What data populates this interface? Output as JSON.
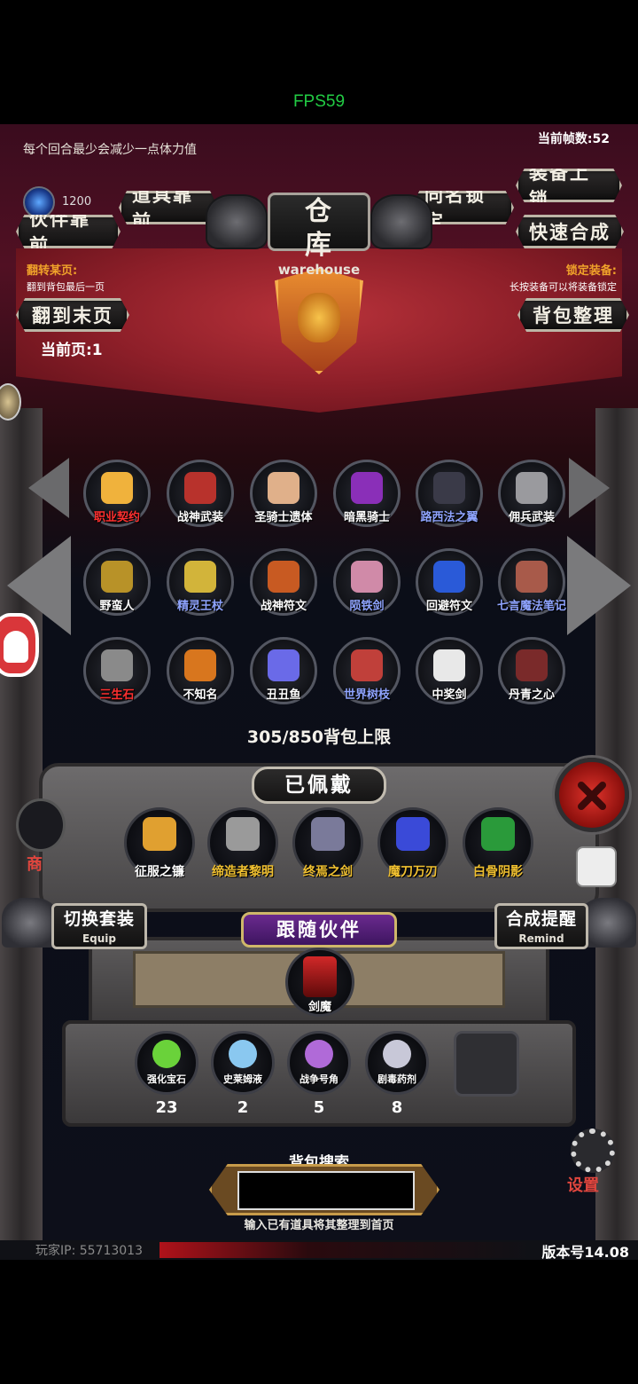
{
  "status": {
    "fps": "FPS59"
  },
  "header": {
    "hint": "每个回合最少会减少一点体力值",
    "current_fps": "当前帧数:52",
    "gem_count": "1200"
  },
  "title": {
    "cn": "仓 库",
    "en": "warehouse"
  },
  "buttons": {
    "items_front": "道具靠前",
    "partners_front": "伙伴靠前",
    "same_name_lock": "同名锁定",
    "equip_lock": "装备上锁",
    "quick_merge": "快速合成",
    "to_last_page": "翻到末页",
    "sort_bag": "背包整理"
  },
  "labels": {
    "flip_page": "翻转某页:",
    "flip_page_sub": "翻到背包最后一页",
    "lock_equip": "锁定装备:",
    "lock_equip_sub": "长按装备可以将装备锁定",
    "current_page": "当前页:1",
    "capacity": "305/850背包上限"
  },
  "inventory": [
    {
      "name": "职业契约",
      "color": "#ff3030",
      "art": "#f0b23c"
    },
    {
      "name": "战神武装",
      "color": "#ffffff",
      "art": "#b8322c"
    },
    {
      "name": "圣骑士遗体",
      "color": "#ffffff",
      "art": "#e0b08a"
    },
    {
      "name": "暗黑骑士",
      "color": "#ffffff",
      "art": "#8a2fb8"
    },
    {
      "name": "路西法之翼",
      "color": "#8fa4ff",
      "art": "#3a3a48"
    },
    {
      "name": "佣兵武装",
      "color": "#ffffff",
      "art": "#9a9a9e"
    },
    {
      "name": "野蛮人",
      "color": "#ffffff",
      "art": "#b89228"
    },
    {
      "name": "精灵王杖",
      "color": "#8fa4ff",
      "art": "#d2b43a"
    },
    {
      "name": "战神符文",
      "color": "#ffffff",
      "art": "#c85a22"
    },
    {
      "name": "陨铁剑",
      "color": "#8fa4ff",
      "art": "#d08aa8"
    },
    {
      "name": "回避符文",
      "color": "#ffffff",
      "art": "#2a5ad8"
    },
    {
      "name": "七言魔法笔记",
      "color": "#8fa4ff",
      "art": "#a85a4a"
    },
    {
      "name": "三生石",
      "color": "#ff3030",
      "art": "#8a8a8a"
    },
    {
      "name": "不知名",
      "color": "#ffffff",
      "art": "#d8761e"
    },
    {
      "name": "丑丑鱼",
      "color": "#ffffff",
      "art": "#6a6ae8"
    },
    {
      "name": "世界树枝",
      "color": "#8fa4ff",
      "art": "#c0403a"
    },
    {
      "name": "中奖剑",
      "color": "#ffffff",
      "art": "#e8e8e8"
    },
    {
      "name": "丹青之心",
      "color": "#ffffff",
      "art": "#7a2a2a"
    }
  ],
  "equipped": {
    "title": "已佩戴",
    "items": [
      {
        "name": "征服之镰",
        "color": "#ffffff",
        "art": "#e0a030"
      },
      {
        "name": "缔造者黎明",
        "color": "#f0c030",
        "art": "#9a9a9a"
      },
      {
        "name": "终焉之剑",
        "color": "#f0c030",
        "art": "#7a7a9a"
      },
      {
        "name": "魔刀万刃",
        "color": "#f0c030",
        "art": "#3a4ad8"
      },
      {
        "name": "白骨阴影",
        "color": "#f0c030",
        "art": "#2a9a3a"
      }
    ]
  },
  "switch_outfit": {
    "cn": "切换套装",
    "en": "Equip"
  },
  "merge_remind": {
    "cn": "合成提醒",
    "en": "Remind"
  },
  "partner": {
    "title": "跟随伙伴",
    "name": "剑魔"
  },
  "consumables": [
    {
      "name": "强化宝石",
      "count": "23",
      "art": "#6ad23a"
    },
    {
      "name": "史莱姆液",
      "count": "2",
      "art": "#8ac8f0"
    },
    {
      "name": "战争号角",
      "count": "5",
      "art": "#b06ad8"
    },
    {
      "name": "剧毒药剂",
      "count": "8",
      "art": "#c8c8d8"
    }
  ],
  "side": {
    "shop": "商",
    "settings": "设置"
  },
  "search": {
    "title": "背包搜索",
    "value": "",
    "hint": "输入已有道具将其整理到首页"
  },
  "footer": {
    "player_ip": "玩家IP: 55713013",
    "version": "版本号14.08"
  }
}
